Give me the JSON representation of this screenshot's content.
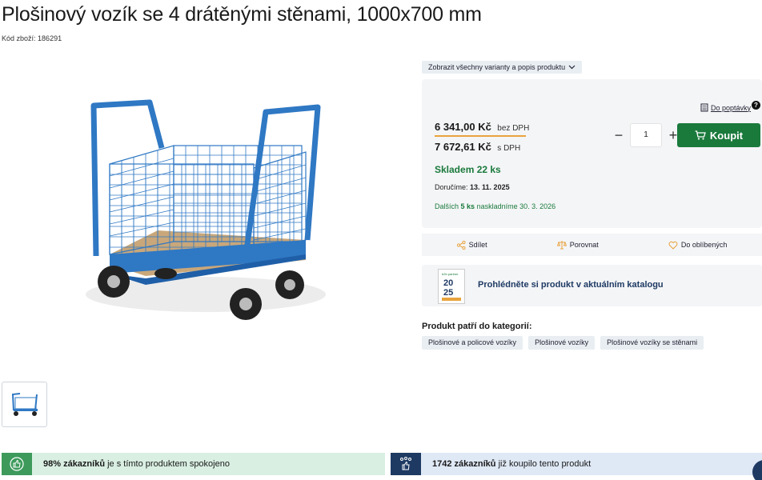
{
  "product": {
    "title": "Plošinový vozík se 4 drátěnými stěnami, 1000x700 mm",
    "code_label": "Kód zboží:",
    "code_value": "186291"
  },
  "variants_link": "Zobrazit všechny varianty a popis produktu",
  "inquiry_link": "Do poptávky",
  "help_icon_text": "?",
  "price": {
    "ex_vat_amount": "6 341,00 Kč",
    "ex_vat_label": "bez DPH",
    "inc_vat_amount": "7 672,61 Kč",
    "inc_vat_label": "s DPH"
  },
  "quantity": {
    "minus": "−",
    "value": "1",
    "plus": "+"
  },
  "buy_button": "Koupit",
  "stock": {
    "status": "Skladem 22 ks",
    "delivery_label": "Doručíme:",
    "delivery_date": "13. 11. 2025",
    "restock_prefix": "Dalších",
    "restock_qty": "5 ks",
    "restock_suffix": "naskladníme 30. 3. 2026"
  },
  "actions": {
    "share": "Sdílet",
    "compare": "Porovnat",
    "favorite": "Do oblíbených"
  },
  "catalog": {
    "text": "Prohlédněte si produkt v aktuálním katalogu",
    "cover_brand": "b2b partner",
    "cover_year_top": "20",
    "cover_year_bottom": "25"
  },
  "categories": {
    "heading": "Produkt patří do kategorií:",
    "items": [
      "Plošinové a policové vozíky",
      "Plošinové vozíky",
      "Plošinové vozíky se stěnami"
    ]
  },
  "satisfaction": {
    "bold": "98% zákazníků",
    "rest": "je s tímto produktem spokojeno"
  },
  "bought": {
    "bold": "1742 zákazníků",
    "rest": "již koupilo tento produkt"
  },
  "colors": {
    "buy_green": "#1a7a3c",
    "stock_green": "#1a7a3c",
    "price_underline": "#e8a33d",
    "catalog_blue": "#1e3a63",
    "cart_blue": "#2f78c4"
  }
}
